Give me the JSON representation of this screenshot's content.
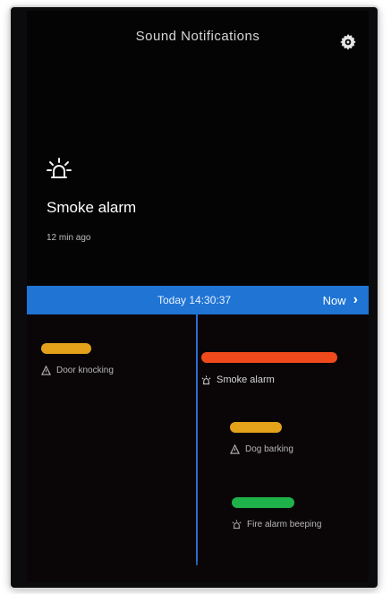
{
  "app": {
    "title": "Sound Notifications",
    "settings_icon": "gear-icon"
  },
  "latest_alert": {
    "icon": "alarm-light-icon",
    "title": "Smoke alarm",
    "time_ago": "12 min ago"
  },
  "timeline_header": {
    "current_time": "Today 14:30:37",
    "now_label": "Now",
    "now_icon": "chevron-right-icon",
    "color": "#1f74d4"
  },
  "events": [
    {
      "label": "Door knocking",
      "icon": "warning-icon",
      "color": "#e3a21a"
    },
    {
      "label": "Smoke alarm",
      "icon": "alarm-light-icon",
      "color": "#f04a1c"
    },
    {
      "label": "Dog barking",
      "icon": "warning-icon",
      "color": "#e3a21a"
    },
    {
      "label": "Fire alarm beeping",
      "icon": "alarm-light-icon",
      "color": "#1fb14a"
    }
  ]
}
